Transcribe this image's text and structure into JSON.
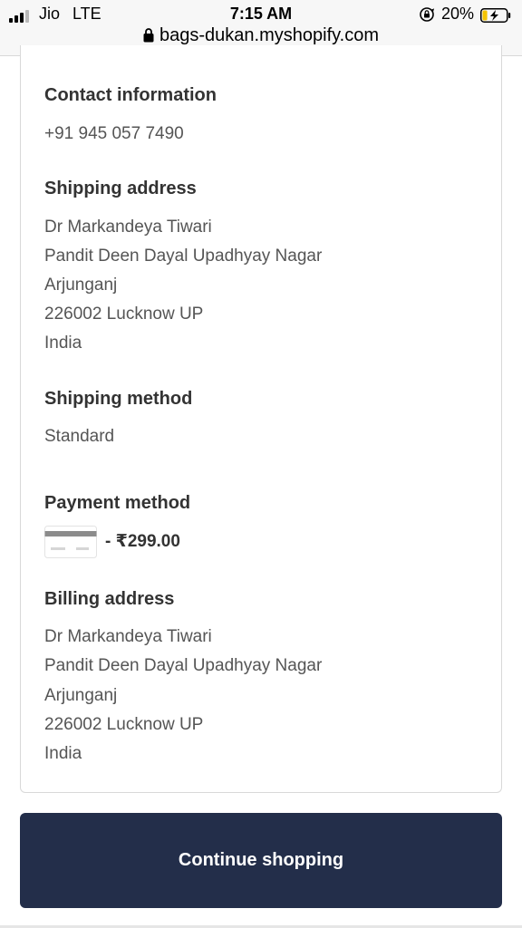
{
  "status_bar": {
    "carrier": "Jio",
    "network": "LTE",
    "time": "7:15 AM",
    "battery": "20%",
    "battery_level": 0.2,
    "icons": [
      "signal-icon",
      "rotation-lock-icon",
      "battery-charging-icon"
    ]
  },
  "browser": {
    "url": "bags-dukan.myshopify.com",
    "icon": "lock-icon"
  },
  "order_summary": {
    "contact": {
      "title": "Contact information",
      "phone": "+91 945 057 7490"
    },
    "shipping_address": {
      "title": "Shipping address",
      "lines": [
        "Dr Markandeya Tiwari",
        "Pandit Deen Dayal Upadhyay Nagar",
        "Arjunganj",
        "226002 Lucknow UP",
        "India"
      ]
    },
    "shipping_method": {
      "title": "Shipping method",
      "value": "Standard"
    },
    "payment_method": {
      "title": "Payment method",
      "icon": "credit-card-icon",
      "amount": "- ₹299.00"
    },
    "billing_address": {
      "title": "Billing address",
      "lines": [
        "Dr Markandeya Tiwari",
        "Pandit Deen Dayal Upadhyay Nagar",
        "Arjunganj",
        "226002 Lucknow UP",
        "India"
      ]
    }
  },
  "actions": {
    "continue_label": "Continue shopping"
  },
  "colors": {
    "button_bg": "#232e4a",
    "button_text": "#ffffff",
    "heading": "#333333",
    "body_text": "#555555",
    "battery_fill": "#f5c400"
  }
}
